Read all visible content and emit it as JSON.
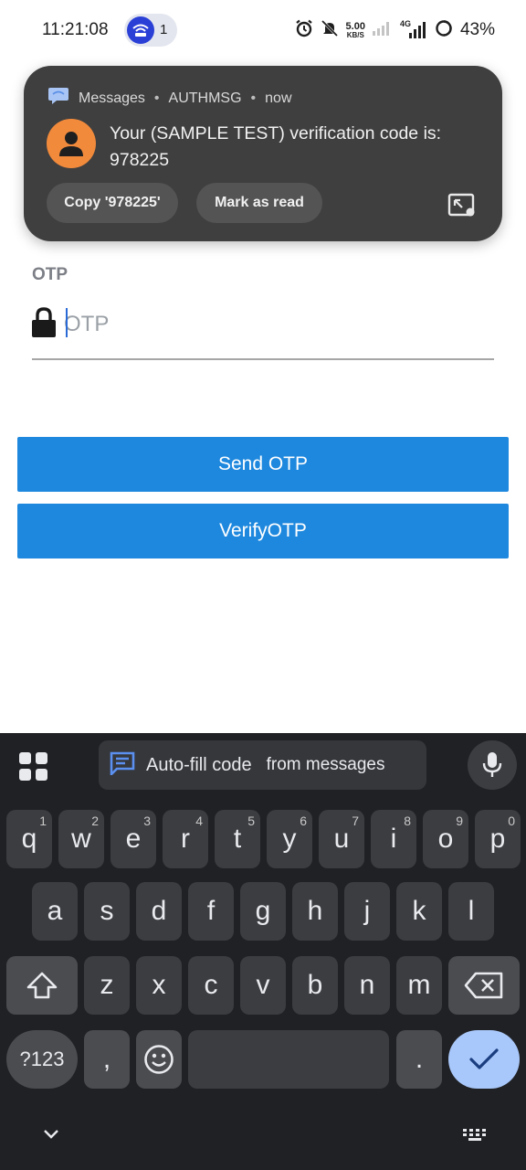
{
  "status_bar": {
    "time": "11:21:08",
    "hotspot_count": "1",
    "speed_value": "5.00",
    "speed_unit": "KB/S",
    "network_type": "4G",
    "battery_percent": "43%"
  },
  "notification": {
    "app": "Messages",
    "sender": "AUTHMSG",
    "time": "now",
    "body": "Your (SAMPLE TEST) verification code is: 978225",
    "actions": {
      "copy": "Copy '978225'",
      "mark_read": "Mark as read"
    },
    "avatar_color": "#f28a3c"
  },
  "form": {
    "otp_label": "OTP",
    "otp_placeholder": "OTP",
    "otp_value": "",
    "send_button": "Send OTP",
    "verify_button": "VerifyOTP",
    "button_color": "#1e88de"
  },
  "keyboard": {
    "autofill_main": "Auto-fill code",
    "autofill_sub": "from messages",
    "row1": [
      {
        "k": "q",
        "h": "1"
      },
      {
        "k": "w",
        "h": "2"
      },
      {
        "k": "e",
        "h": "3"
      },
      {
        "k": "r",
        "h": "4"
      },
      {
        "k": "t",
        "h": "5"
      },
      {
        "k": "y",
        "h": "6"
      },
      {
        "k": "u",
        "h": "7"
      },
      {
        "k": "i",
        "h": "8"
      },
      {
        "k": "o",
        "h": "9"
      },
      {
        "k": "p",
        "h": "0"
      }
    ],
    "row2": [
      "a",
      "s",
      "d",
      "f",
      "g",
      "h",
      "j",
      "k",
      "l"
    ],
    "row3": [
      "z",
      "x",
      "c",
      "v",
      "b",
      "n",
      "m"
    ],
    "symbols_key": "?123",
    "comma_key": ",",
    "period_key": ".",
    "enter_color": "#a8c7fa"
  }
}
